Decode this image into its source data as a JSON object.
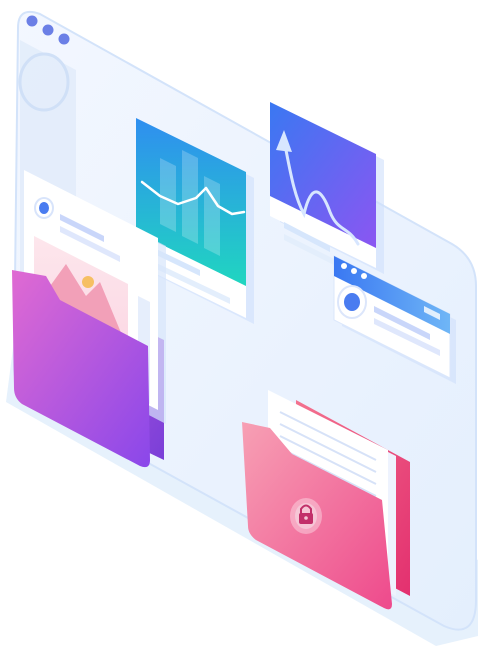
{
  "illustration": {
    "colors": {
      "window_fill": "#eef4ff",
      "window_edge": "#cfe1fb",
      "window_shadow": "#dcebfb",
      "sidebar": "#e3eefc",
      "dot": "#6f86e8",
      "teal_top": "#2f9bea",
      "teal_bottom": "#20d3c2",
      "blue_top": "#3a7df0",
      "blue_bottom": "#8a5cf2",
      "purple_front": "#a24be8",
      "purple_back": "#e06ad2",
      "pink_front": "#f2578f",
      "pink_back": "#f6a0b6",
      "card_bar": "#cfe0fb",
      "chart_line": "#ffffff"
    },
    "icons": {
      "window_dots": "three-dots-icon",
      "lock": "padlock-icon",
      "image": "image-placeholder-icon",
      "trend": "trend-arrow-icon",
      "avatar": "avatar-circle-icon"
    },
    "elements": {
      "background_window": "browser-window",
      "teal_card": "line-chart-card",
      "blue_card": "trend-chart-card",
      "profile_card": "profile-mini-window",
      "photo_folder": "image-folder",
      "document_folder": "locked-document-folder"
    }
  }
}
